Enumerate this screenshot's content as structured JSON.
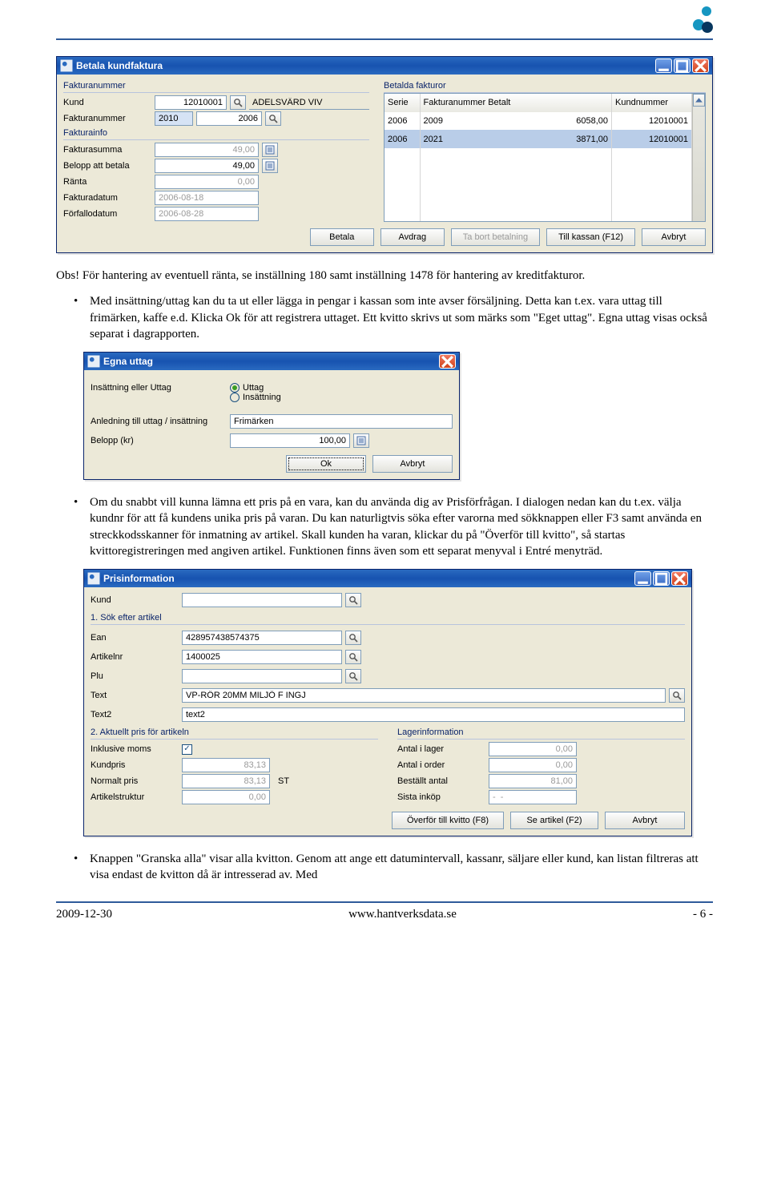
{
  "doc": {
    "para1_pre": "Obs! För hantering av eventuell ränta, se inställning 180 samt inställning 1478 för hantering av kreditfakturor.",
    "bullet1": "Med insättning/uttag kan du ta ut eller lägga in pengar i kassan som inte avser försäljning. Detta kan t.ex. vara uttag till frimärken, kaffe e.d. Klicka Ok för att registrera uttaget. Ett kvitto skrivs ut som märks som \"Eget uttag\". Egna uttag visas också separat i dagrapporten.",
    "bullet2": "Om du snabbt vill kunna lämna ett pris på en vara, kan du använda dig av Prisförfrågan. I dialogen nedan kan du t.ex. välja kundnr för att få kundens unika pris på varan. Du kan naturligtvis söka efter varorna med sökknappen eller F3 samt använda en streckkodsskanner för inmatning av artikel. Skall kunden ha varan, klickar du på \"Överför till kvitto\", så startas kvittoregistreringen med angiven artikel. Funktionen finns även som ett separat menyval i Entré menyträd.",
    "bullet3": "Knappen \"Granska alla\" visar alla kvitton. Genom att ange ett datumintervall, kassanr, säljare eller kund, kan listan filtreras att visa endast de kvitton då är intresserad av. Med",
    "footer_date": "2009-12-30",
    "footer_url": "www.hantverksdata.se",
    "footer_page": "- 6 -"
  },
  "win1": {
    "title": "Betala kundfaktura",
    "group_fakt": "Fakturanummer",
    "group_betalda": "Betalda fakturor",
    "group_info": "Fakturainfo",
    "lbl_kund": "Kund",
    "val_kund": "12010001",
    "val_kundnamn": "ADELSVÄRD VIV",
    "lbl_faktnr": "Fakturanummer",
    "val_faktnr1": "2010",
    "val_faktnr2": "2006",
    "lbl_summa": "Fakturasumma",
    "val_summa": "49,00",
    "lbl_betala": "Belopp att betala",
    "val_betala": "49,00",
    "lbl_ranta": "Ränta",
    "val_ranta": "0,00",
    "lbl_datum": "Fakturadatum",
    "val_datum": "2006-08-18",
    "lbl_forfall": "Förfallodatum",
    "val_forfall": "2006-08-28",
    "table": {
      "h_serie": "Serie",
      "h_fnrb": "Fakturanummer Betalt",
      "h_knr": "Kundnummer",
      "rows": [
        {
          "serie": "2006",
          "fnr": "2009",
          "belopp": "6058,00",
          "knr": "12010001"
        },
        {
          "serie": "2006",
          "fnr": "2021",
          "belopp": "3871,00",
          "knr": "12010001"
        }
      ]
    },
    "btn_betala": "Betala",
    "btn_avdrag": "Avdrag",
    "btn_tabort": "Ta bort betalning",
    "btn_kassa": "Till kassan (F12)",
    "btn_avbryt": "Avbryt"
  },
  "win2": {
    "title": "Egna uttag",
    "lbl_inut": "Insättning eller Uttag",
    "opt_uttag": "Uttag",
    "opt_insattning": "Insättning",
    "lbl_anledning": "Anledning till uttag / insättning",
    "val_anledning": "Frimärken",
    "lbl_belopp": "Belopp (kr)",
    "val_belopp": "100,00",
    "btn_ok": "Ok",
    "btn_avbryt": "Avbryt"
  },
  "win3": {
    "title": "Prisinformation",
    "lbl_kund": "Kund",
    "group1": "1. Sök efter artikel",
    "lbl_ean": "Ean",
    "val_ean": "428957438574375",
    "lbl_artnr": "Artikelnr",
    "val_artnr": "1400025",
    "lbl_plu": "Plu",
    "val_plu": "",
    "lbl_text": "Text",
    "val_text": "VP-RÖR 20MM MILJÖ F INGJ",
    "lbl_text2": "Text2",
    "val_text2": "text2",
    "group2": "2. Aktuellt pris för artikeln",
    "lbl_inkmoms": "Inklusive moms",
    "lbl_kundpris": "Kundpris",
    "val_kundpris": "83,13",
    "lbl_normal": "Normalt pris",
    "val_normal": "83,13",
    "val_enhet": "ST",
    "lbl_struktur": "Artikelstruktur",
    "val_struktur": "0,00",
    "group_lager": "Lagerinformation",
    "lbl_lager": "Antal i lager",
    "val_lager": "0,00",
    "lbl_order": "Antal i order",
    "val_order": "0,00",
    "lbl_best": "Beställt antal",
    "val_best": "81,00",
    "lbl_sista": "Sista inköp",
    "val_sista": "-  -",
    "btn_overfor": "Överför till kvitto (F8)",
    "btn_seart": "Se artikel (F2)",
    "btn_avbryt": "Avbryt"
  }
}
